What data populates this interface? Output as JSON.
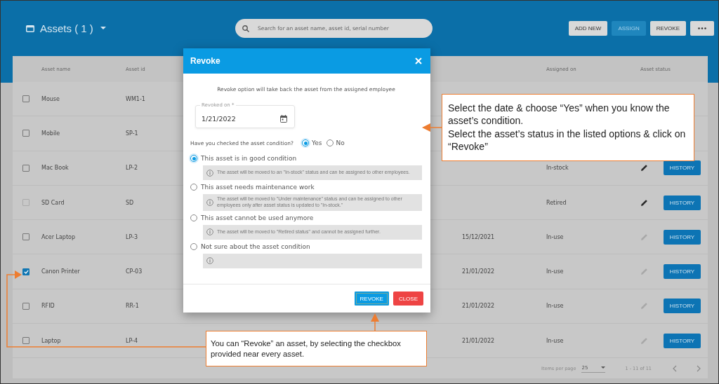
{
  "header": {
    "title": "Assets ( 1 )",
    "search": {
      "placeholder": "Search for an asset name, asset id, serial number"
    },
    "actions": [
      {
        "label": "ADD NEW",
        "disabled": false
      },
      {
        "label": "ASSIGN",
        "disabled": true
      },
      {
        "label": "REVOKE",
        "disabled": false
      }
    ]
  },
  "table": {
    "columns": [
      "Asset name",
      "Asset id",
      "Assigned on",
      "Asset status"
    ],
    "rows": [
      {
        "checked": false,
        "disabled": false,
        "name": "Mouse",
        "asset_id": "WM1-1"
      },
      {
        "checked": false,
        "disabled": false,
        "name": "Mobile",
        "asset_id": "SP-1"
      },
      {
        "checked": false,
        "disabled": false,
        "name": "Mac Book",
        "asset_id": "LP-2",
        "status": "In-stock",
        "edit_enabled": true,
        "action": "HISTORY"
      },
      {
        "checked": false,
        "disabled": true,
        "name": "SD Card",
        "asset_id": "SD",
        "status": "Retired",
        "edit_enabled": true,
        "action": "HISTORY"
      },
      {
        "checked": false,
        "disabled": false,
        "name": "Acer Laptop",
        "asset_id": "LP-3",
        "assigned_on": "15/12/2021",
        "status": "In-use",
        "edit_enabled": false,
        "action": "HISTORY"
      },
      {
        "checked": true,
        "disabled": false,
        "name": "Canon Printer",
        "asset_id": "CP-03",
        "assigned_on": "21/01/2022",
        "status": "In-use",
        "edit_enabled": false,
        "action": "HISTORY"
      },
      {
        "checked": false,
        "disabled": false,
        "name": "RFID",
        "asset_id": "RR-1",
        "assigned_on": "21/01/2022",
        "status": "In-use",
        "edit_enabled": false,
        "action": "HISTORY"
      },
      {
        "checked": false,
        "disabled": false,
        "name": "Laptop",
        "asset_id": "LP-4",
        "assigned_on": "21/01/2022",
        "status": "In-use",
        "edit_enabled": false,
        "action": "HISTORY"
      }
    ]
  },
  "pagination": {
    "label": "Items per page",
    "page_size": "25",
    "range": "1 - 11 of 11"
  },
  "dialog": {
    "title": "Revoke",
    "intro": "Revoke option will take back the asset from the assigned employee",
    "date_field": {
      "label": "Revoked on *",
      "value": "1/21/2022"
    },
    "question": "Have you checked the asset condition?",
    "answers": [
      {
        "label": "Yes",
        "selected": true
      },
      {
        "label": "No",
        "selected": false
      }
    ],
    "options": [
      {
        "label": "This asset is in good condition",
        "selected": true,
        "info": "The asset will be moved to an \"In-stock\" status and can be assigned to other employees."
      },
      {
        "label": "This asset needs maintenance work",
        "selected": false,
        "info": "The asset will be moved to \"Under maintenance\" status and can be assigned to other employees only after asset status is updated to \"In-stock.\""
      },
      {
        "label": "This asset cannot be used anymore",
        "selected": false,
        "info": "The asset will be moved to \"Retired status\" and cannot be assigned further."
      },
      {
        "label": "Not sure about the asset condition",
        "selected": false
      }
    ],
    "buttons": [
      {
        "label": "REVOKE",
        "kind": "primary"
      },
      {
        "label": "CLOSE",
        "kind": "danger"
      }
    ]
  },
  "callouts": [
    {
      "lines": [
        "Select the date & choose “Yes” when you know the asset’s condition.",
        "Select the asset’s status in the listed options & click on “Revoke”"
      ]
    },
    {
      "lines": [
        "You can “Revoke” an asset, by selecting the checkbox provided near every asset."
      ]
    }
  ]
}
